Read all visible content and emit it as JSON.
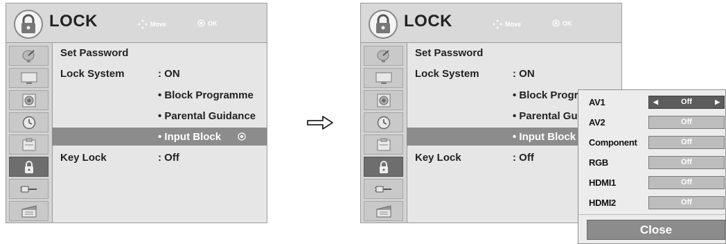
{
  "menu": {
    "title": "LOCK",
    "nav_hint": "Move",
    "ok_hint": "OK",
    "rows": [
      {
        "label": "Set Password",
        "value": ""
      },
      {
        "label": "Lock System",
        "value": ": ON"
      },
      {
        "label": "",
        "value": "• Block Programme"
      },
      {
        "label": "",
        "value": "• Parental Guidance"
      },
      {
        "label": "",
        "value": "• Input Block"
      },
      {
        "label": "Key Lock",
        "value": ": Off"
      }
    ]
  },
  "sidebar": {
    "items": [
      {
        "icon": "satellite-dish-icon"
      },
      {
        "icon": "picture-icon"
      },
      {
        "icon": "audio-speaker-icon"
      },
      {
        "icon": "clock-icon"
      },
      {
        "icon": "option-icon"
      },
      {
        "icon": "lock-icon",
        "active": true
      },
      {
        "icon": "input-cable-icon"
      },
      {
        "icon": "usb-media-icon"
      }
    ]
  },
  "popup": {
    "inputs": [
      {
        "name": "AV1",
        "value": "Off"
      },
      {
        "name": "AV2",
        "value": "Off"
      },
      {
        "name": "Component",
        "value": "Off"
      },
      {
        "name": "RGB",
        "value": "Off"
      },
      {
        "name": "HDMI1",
        "value": "Off"
      },
      {
        "name": "HDMI2",
        "value": "Off"
      }
    ],
    "close_label": "Close"
  }
}
